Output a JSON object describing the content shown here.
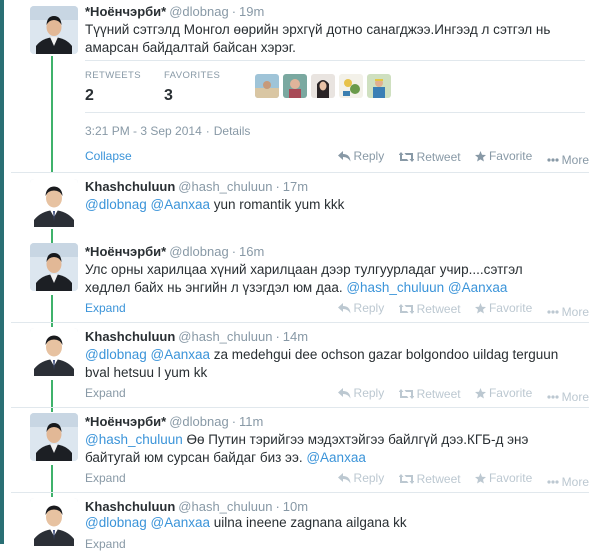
{
  "main_tweet": {
    "name": "*Ноёнчэрби*",
    "handle": "@dlobnag",
    "time": "19m",
    "text": "Түүний сэтгэлд Монгол өөрийн эрхгүй дотно санагджээ.Ингээд л сэтгэл нь амарсан байдалтай байсан хэрэг.",
    "retweets_label": "RETWEETS",
    "retweets_count": "2",
    "favorites_label": "FAVORITES",
    "favorites_count": "3",
    "timestamp": "3:21 PM - 3 Sep 2014",
    "details_label": "Details",
    "collapse_label": "Collapse"
  },
  "actions": {
    "reply": "Reply",
    "retweet": "Retweet",
    "favorite": "Favorite",
    "more": "More",
    "expand": "Expand",
    "separator": "·"
  },
  "replies": [
    {
      "name": "Khashchuluun",
      "handle": "@hash_chuluun",
      "time": "17m",
      "m1": "@dlobnag",
      "m2": "@Aanxaa",
      "rest": " yun romantik yum kkk"
    },
    {
      "name": "*Ноёнчэрби*",
      "handle": "@dlobnag",
      "time": "16m",
      "line1": "Улс орны харилцаа хүний харилцаан дээр тулгуурладаг учир....сэтгэл",
      "line2": "хөдлөл байх нь энгийн л үзэгдэл юм даа. ",
      "m1": "@hash_chuluun",
      "m2": "@Aanxaa"
    },
    {
      "name": "Khashchuluun",
      "handle": "@hash_chuluun",
      "time": "14m",
      "m1": "@dlobnag",
      "m2": "@Aanxaa",
      "line1": " za medehgui dee ochson gazar bolgondoo uildag terguun",
      "line2": "bval hetsuu l yum kk"
    },
    {
      "name": "*Ноёнчэрби*",
      "handle": "@dlobnag",
      "time": "11m",
      "m1": "@hash_chuluun",
      "line1": " Өө Путин тэрийгээ мэдэхтэйгээ байлгүй дээ.КГБ-д энэ",
      "line2": "байтугай юм сурсан байдаг биз ээ. ",
      "m2": "@Aanxaa"
    },
    {
      "name": "Khashchuluun",
      "handle": "@hash_chuluun",
      "time": "10m",
      "m1": "@dlobnag",
      "m2": "@Aanxaa",
      "rest": " uilna ineene zagnana ailgana kk"
    }
  ],
  "colors": {
    "link": "#3b94d9",
    "muted": "#8899a6",
    "thread_line": "#3fb26b"
  }
}
